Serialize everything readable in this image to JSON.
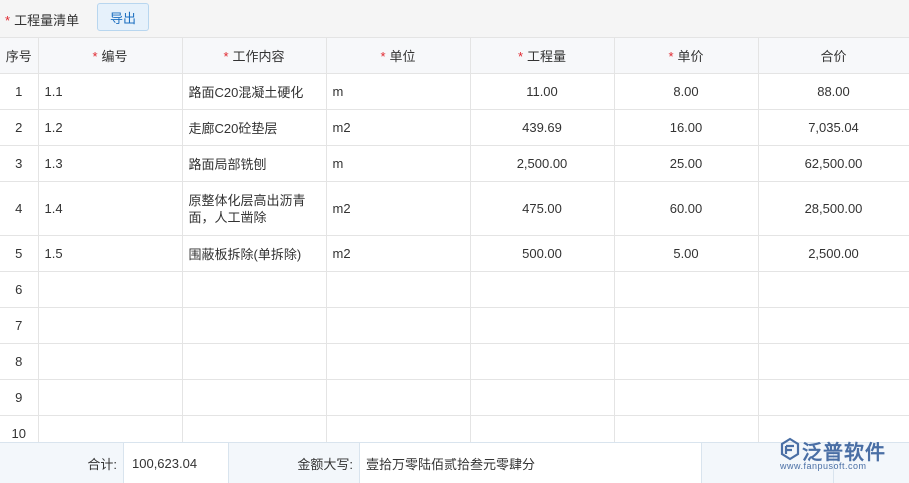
{
  "toolbar": {
    "title": "工程量清单",
    "export_label": "导出"
  },
  "table": {
    "headers": [
      {
        "label": "序号",
        "required": false
      },
      {
        "label": "编号",
        "required": true
      },
      {
        "label": "工作内容",
        "required": true
      },
      {
        "label": "单位",
        "required": true
      },
      {
        "label": "工程量",
        "required": true
      },
      {
        "label": "单价",
        "required": true
      },
      {
        "label": "合价",
        "required": false
      }
    ],
    "rows": [
      {
        "seq": "1",
        "code": "1.1",
        "content": "路面C20混凝土硬化",
        "unit": "m",
        "qty": "11.00",
        "price": "8.00",
        "total": "88.00"
      },
      {
        "seq": "2",
        "code": "1.2",
        "content": "走廊C20砼垫层",
        "unit": "m2",
        "qty": "439.69",
        "price": "16.00",
        "total": "7,035.04"
      },
      {
        "seq": "3",
        "code": "1.3",
        "content": "路面局部铣刨",
        "unit": "m",
        "qty": "2,500.00",
        "price": "25.00",
        "total": "62,500.00"
      },
      {
        "seq": "4",
        "code": "1.4",
        "content": "原整体化层高出沥青面，人工凿除",
        "unit": "m2",
        "qty": "475.00",
        "price": "60.00",
        "total": "28,500.00"
      },
      {
        "seq": "5",
        "code": "1.5",
        "content": "围蔽板拆除(单拆除)",
        "unit": "m2",
        "qty": "500.00",
        "price": "5.00",
        "total": "2,500.00"
      },
      {
        "seq": "6",
        "code": "",
        "content": "",
        "unit": "",
        "qty": "",
        "price": "",
        "total": ""
      },
      {
        "seq": "7",
        "code": "",
        "content": "",
        "unit": "",
        "qty": "",
        "price": "",
        "total": ""
      },
      {
        "seq": "8",
        "code": "",
        "content": "",
        "unit": "",
        "qty": "",
        "price": "",
        "total": ""
      },
      {
        "seq": "9",
        "code": "",
        "content": "",
        "unit": "",
        "qty": "",
        "price": "",
        "total": ""
      },
      {
        "seq": "10",
        "code": "",
        "content": "",
        "unit": "",
        "qty": "",
        "price": "",
        "total": ""
      }
    ]
  },
  "footer": {
    "sum_label": "合计:",
    "sum_value": "100,623.04",
    "amount_label": "金额大写:",
    "amount_value": "壹拾万零陆佰贰拾叁元零肆分"
  },
  "logo": {
    "name": "泛普软件",
    "url": "www.fanpusoft.com",
    "icon": "fanpu-logo-icon",
    "color": "#4a6fa5"
  },
  "colors": {
    "required_star": "#e0262e",
    "accent": "#1c6fc0"
  }
}
